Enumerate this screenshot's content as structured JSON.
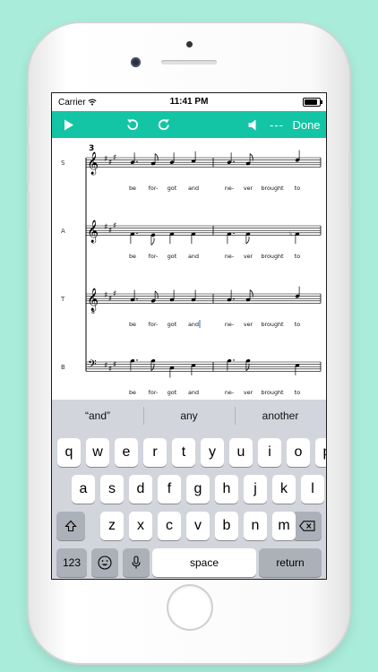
{
  "status_bar": {
    "carrier": "Carrier",
    "time": "11:41 PM",
    "battery_level": 0.9
  },
  "toolbar": {
    "dashes": "---",
    "done_label": "Done",
    "color": "#13c5a4"
  },
  "score": {
    "measure_number": "3",
    "staves": [
      {
        "part": "S",
        "lyrics": [
          "be",
          "for-",
          "got",
          "and",
          "ne-",
          "ver",
          "brought",
          "to"
        ]
      },
      {
        "part": "A",
        "lyrics": [
          "be",
          "for-",
          "got",
          "and",
          "ne-",
          "ver",
          "brought",
          "to"
        ]
      },
      {
        "part": "T",
        "lyrics": [
          "be",
          "for-",
          "got",
          "and",
          "ne-",
          "ver",
          "brought",
          "to"
        ]
      },
      {
        "part": "B",
        "lyrics": [
          "be",
          "for-",
          "got",
          "and",
          "ne-",
          "ver",
          "brought",
          "to"
        ]
      }
    ]
  },
  "suggestions": [
    "“and”",
    "any",
    "another"
  ],
  "keyboard": {
    "row1": [
      "q",
      "w",
      "e",
      "r",
      "t",
      "y",
      "u",
      "i",
      "o",
      "p"
    ],
    "row2": [
      "a",
      "s",
      "d",
      "f",
      "g",
      "h",
      "j",
      "k",
      "l"
    ],
    "row3": [
      "z",
      "x",
      "c",
      "v",
      "b",
      "n",
      "m"
    ],
    "numbers_label": "123",
    "space_label": "space",
    "return_label": "return"
  }
}
